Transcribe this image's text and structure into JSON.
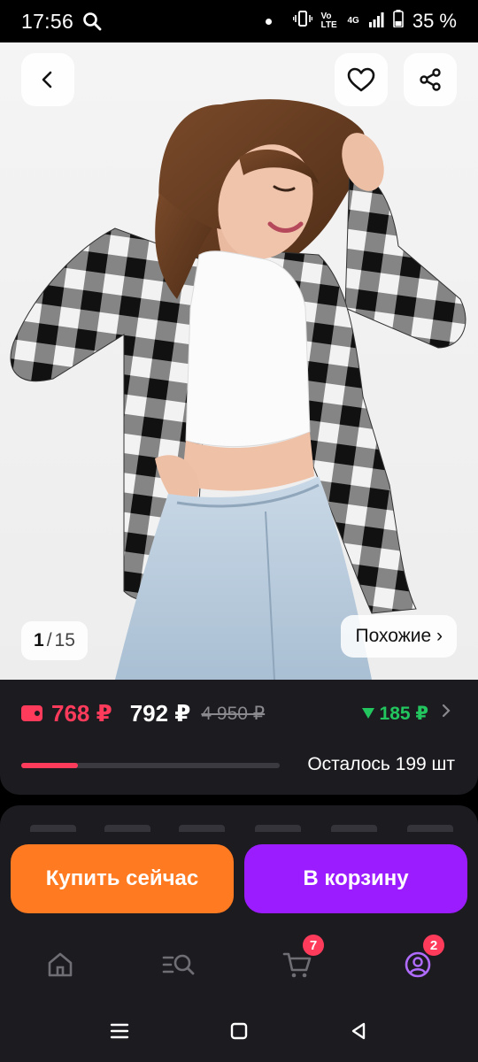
{
  "status_bar": {
    "time": "17:56",
    "battery": "35 %",
    "network_label": "Vo LTE",
    "network_type": "4G"
  },
  "gallery": {
    "current": "1",
    "separator": "/",
    "total": "15",
    "similar_label": "Похожие ›"
  },
  "price": {
    "wallet_price": "768 ₽",
    "current_price": "792 ₽",
    "old_price": "4 950 ₽",
    "saving": "185 ₽",
    "stock_text": "Осталось 199 шт",
    "stock_fraction": 0.22
  },
  "actions": {
    "buy_now": "Купить сейчас",
    "add_to_cart": "В корзину"
  },
  "bottom_nav": {
    "items": [
      {
        "icon": "home-icon"
      },
      {
        "icon": "catalog-search-icon"
      },
      {
        "icon": "cart-icon",
        "badge": "7"
      },
      {
        "icon": "profile-icon",
        "badge": "2"
      }
    ]
  },
  "colors": {
    "accent_red": "#ff3b5c",
    "accent_green": "#22c55e",
    "buy_orange": "#ff7a21",
    "cart_purple": "#9b1dff",
    "panel": "#1c1b20"
  }
}
